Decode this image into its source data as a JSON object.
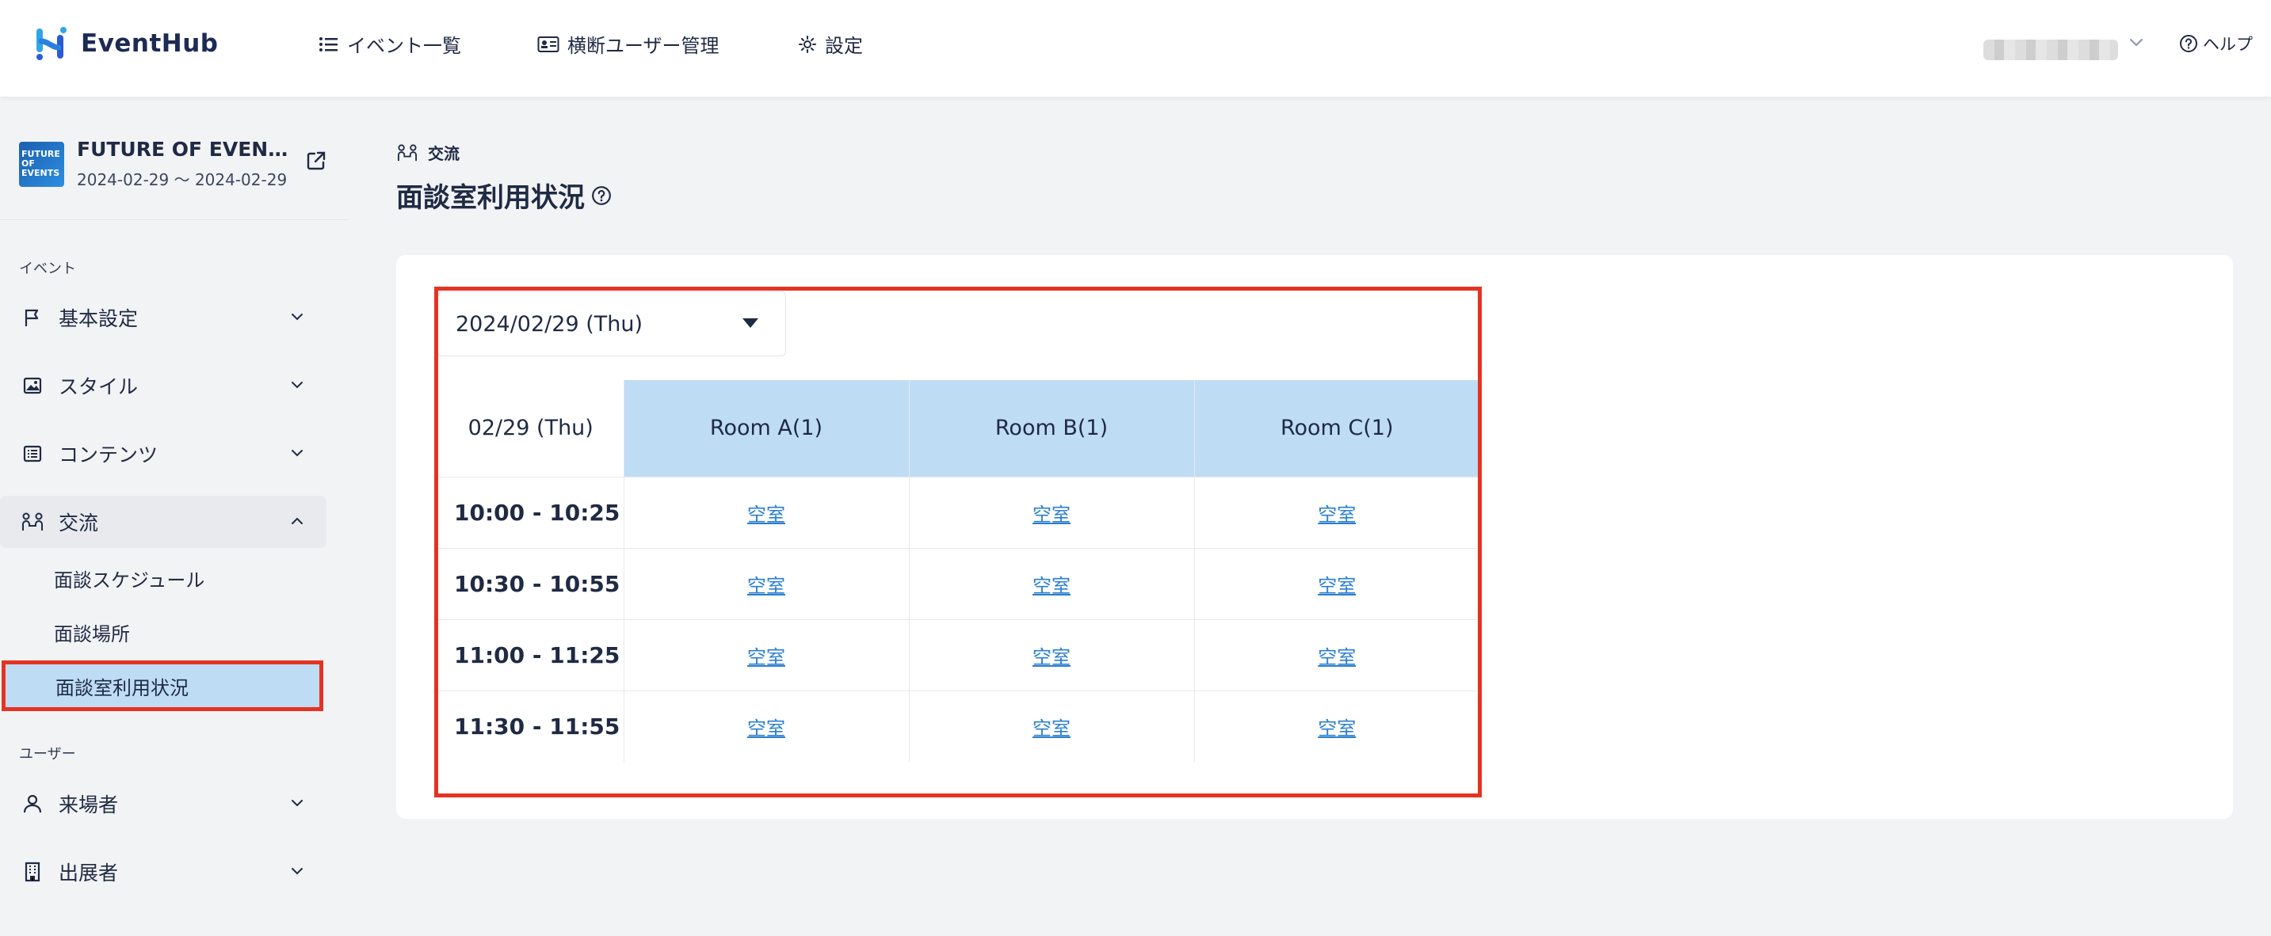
{
  "app": {
    "name": "EventHub",
    "brand_color": "#1c2a55",
    "accent_color": "#2b7fd0",
    "highlight_color": "#e53322"
  },
  "topnav": {
    "items": [
      {
        "label": "イベント一覧",
        "icon": "list-icon"
      },
      {
        "label": "横断ユーザー管理",
        "icon": "id-card-icon"
      },
      {
        "label": "設定",
        "icon": "gear-icon"
      }
    ],
    "help_label": "ヘルプ"
  },
  "event": {
    "thumb_text": "FUTURE OF EVENTS",
    "title": "FUTURE OF EVEN…",
    "dates": "2024-02-29 ～ 2024-02-29"
  },
  "sidebar": {
    "section_event": "イベント",
    "section_user": "ユーザー",
    "items": [
      {
        "label": "基本設定",
        "icon": "flag-icon"
      },
      {
        "label": "スタイル",
        "icon": "image-icon"
      },
      {
        "label": "コンテンツ",
        "icon": "document-list-icon"
      },
      {
        "label": "交流",
        "icon": "networking-icon"
      },
      {
        "label": "来場者",
        "icon": "person-icon"
      },
      {
        "label": "出展者",
        "icon": "building-icon"
      }
    ],
    "sub_items": [
      {
        "label": "面談スケジュール"
      },
      {
        "label": "面談場所"
      },
      {
        "label": "面談室利用状況",
        "active": true
      }
    ]
  },
  "breadcrumb": {
    "label": "交流"
  },
  "page": {
    "title": "面談室利用状況"
  },
  "date_select": {
    "value": "2024/02/29 (Thu)"
  },
  "schedule": {
    "date_header": "02/29 (Thu)",
    "rooms": [
      "Room A(1)",
      "Room B(1)",
      "Room C(1)"
    ],
    "rows": [
      {
        "time": "10:00 - 10:25",
        "cells": [
          "空室",
          "空室",
          "空室"
        ]
      },
      {
        "time": "10:30 - 10:55",
        "cells": [
          "空室",
          "空室",
          "空室"
        ]
      },
      {
        "time": "11:00 - 11:25",
        "cells": [
          "空室",
          "空室",
          "空室"
        ]
      },
      {
        "time": "11:30 - 11:55",
        "cells": [
          "空室",
          "空室",
          "空室"
        ]
      }
    ]
  }
}
